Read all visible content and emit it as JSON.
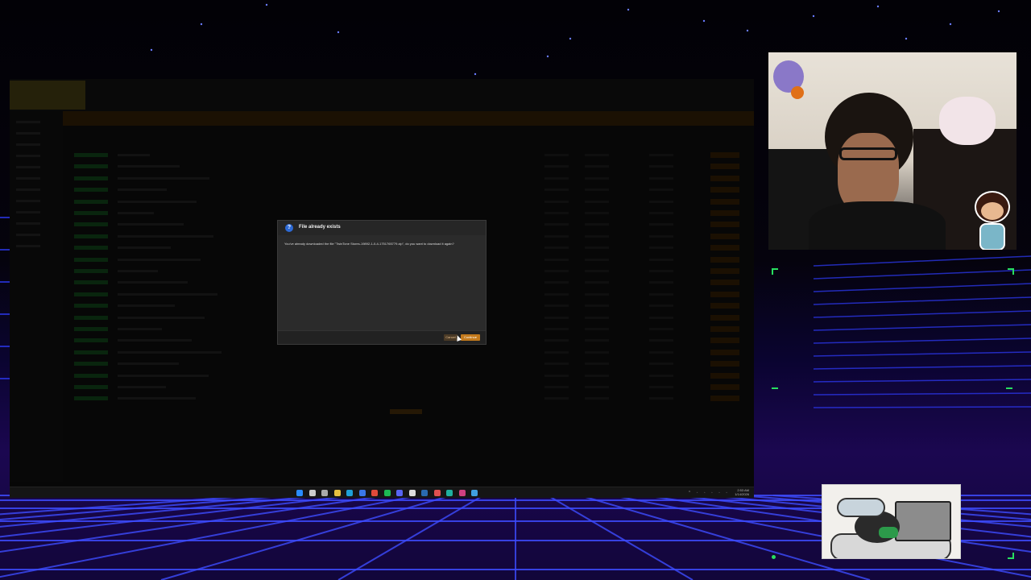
{
  "dialog": {
    "title": "File already exists",
    "info_icon": "info-icon",
    "message": "You've already downloaded the file \"TwinTone Stores-19892-1-0-4-1751765779.zip\", do you want to download it again?",
    "cancel_label": "Cancel",
    "continue_label": "Continue"
  },
  "taskbar": {
    "time": "2:53 AM",
    "date": "1/14/2026",
    "icons": [
      "windows-start-icon",
      "search-icon",
      "task-view-icon",
      "file-explorer-icon",
      "store-icon",
      "edge-icon",
      "chrome-icon",
      "spotify-icon",
      "discord-icon",
      "obs-icon",
      "steam-icon",
      "app-icon",
      "app-icon",
      "app-icon",
      "app-icon"
    ]
  },
  "colors": {
    "accent_orange": "#c47a1c",
    "dialog_info_blue": "#2d6ad6",
    "frame_green": "#28e060",
    "neon_grid": "#3a3aff"
  }
}
